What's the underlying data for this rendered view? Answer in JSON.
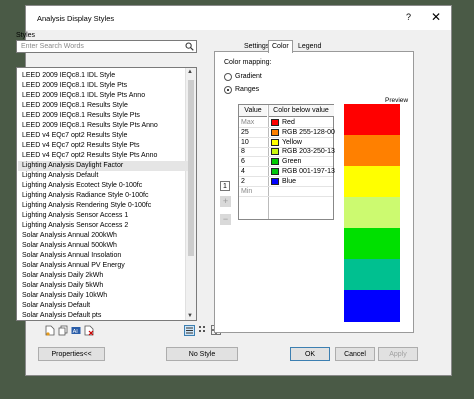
{
  "window": {
    "title": "Analysis Display Styles",
    "help_label": "?",
    "close_label": "✕"
  },
  "styles": {
    "label": "Styles",
    "search_placeholder": "Enter Search Words",
    "items": [
      "LEED 2009 IEQc8.1 IDL Style",
      "LEED 2009 IEQc8.1 IDL Style Pts",
      "LEED 2009 IEQc8.1 IDL Style Pts Anno",
      "LEED 2009 IEQc8.1 Results Style",
      "LEED 2009 IEQc8.1 Results Style Pts",
      "LEED 2009 IEQc8.1 Results Style Pts Anno",
      "LEED v4 EQc7 opt2 Results Style",
      "LEED v4 EQc7 opt2 Results Style Pts",
      "LEED v4 EQc7 opt2 Results Style Pts Anno",
      "Lighting Analysis Daylight Factor",
      "Lighting Analysis Default",
      "Lighting Analysis Ecotect Style 0-100fc",
      "Lighting Analysis Radiance Style 0-100fc",
      "Lighting Analysis Rendering Style 0-100fc",
      "Lighting Analysis Sensor Access 1",
      "Lighting Analysis Sensor Access 2",
      "Solar Analysis Annual 200kWh",
      "Solar Analysis Annual 500kWh",
      "Solar Analysis Annual Insolation",
      "Solar Analysis Annual PV Energy",
      "Solar Analysis Daily 2kWh",
      "Solar Analysis Daily 5kWh",
      "Solar Analysis Daily 10kWh",
      "Solar Analysis Default",
      "Solar Analysis Default pts"
    ],
    "selected_index": 9
  },
  "tabs": [
    "Settings",
    "Color",
    "Legend"
  ],
  "active_tab": "Color",
  "color": {
    "mapping_label": "Color mapping:",
    "gradient_label": "Gradient",
    "ranges_label": "Ranges",
    "selected_mapping": "Ranges",
    "headers": {
      "value": "Value",
      "color": "Color below value"
    },
    "rows": [
      {
        "value": "Max",
        "color_name": "Red",
        "hex": "#ff0000"
      },
      {
        "value": "25",
        "color_name": "RGB 255-128-00",
        "hex": "#ff8000"
      },
      {
        "value": "10",
        "color_name": "Yellow",
        "hex": "#ffff00"
      },
      {
        "value": "8",
        "color_name": "RGB 203-250-13",
        "hex": "#cbfa0d"
      },
      {
        "value": "6",
        "color_name": "Green",
        "hex": "#00cc00"
      },
      {
        "value": "4",
        "color_name": "RGB 001-197-13",
        "hex": "#01c50d"
      },
      {
        "value": "2",
        "color_name": "Blue",
        "hex": "#0000ff"
      },
      {
        "value": "Min",
        "color_name": "",
        "hex": ""
      }
    ],
    "count_value": "1",
    "add_label": "+",
    "remove_label": "−",
    "preview_label": "Preview",
    "preview_colors": [
      "#ff0000",
      "#ff8000",
      "#ffff00",
      "#ccfa70",
      "#00e000",
      "#00c090",
      "#0000ff"
    ]
  },
  "buttons": {
    "properties": "Properties<<",
    "no_style": "No Style",
    "ok": "OK",
    "cancel": "Cancel",
    "apply": "Apply"
  }
}
